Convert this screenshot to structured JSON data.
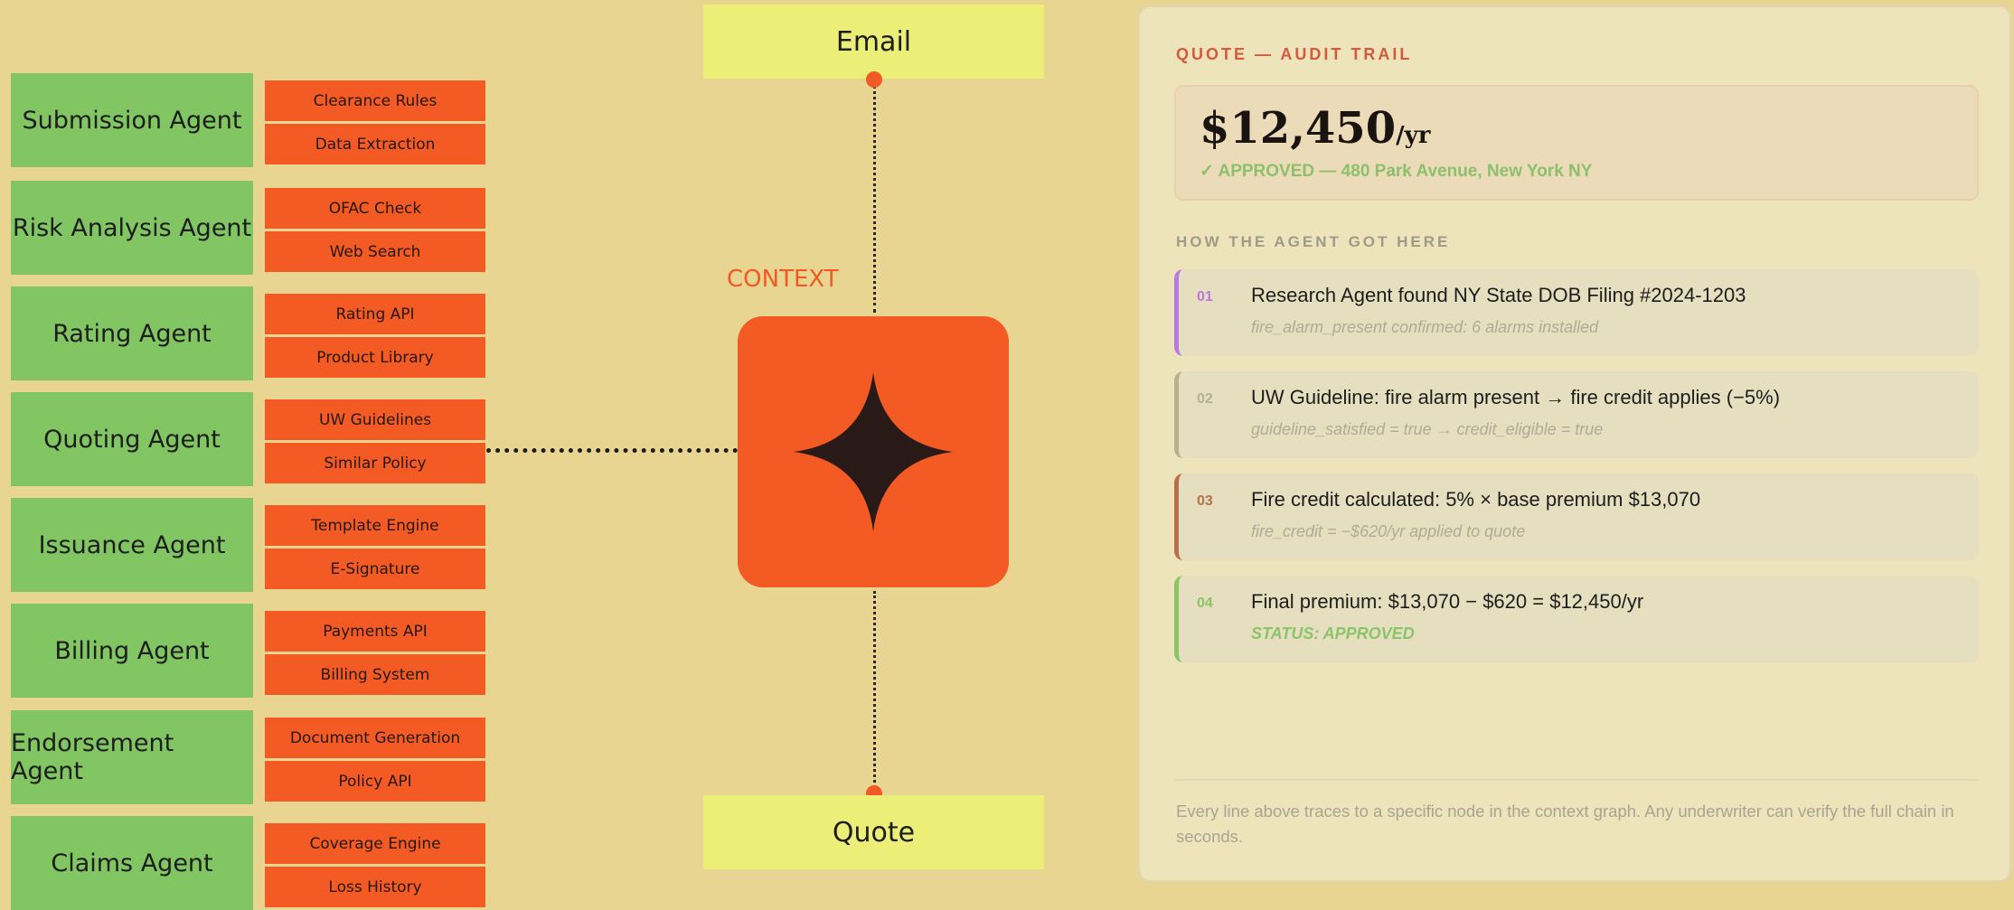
{
  "agents": [
    {
      "name": "Submission Agent",
      "tools": [
        "Clearance Rules",
        "Data Extraction"
      ]
    },
    {
      "name": "Risk Analysis Agent",
      "tools": [
        "OFAC Check",
        "Web Search"
      ]
    },
    {
      "name": "Rating Agent",
      "tools": [
        "Rating API",
        "Product Library"
      ]
    },
    {
      "name": "Quoting Agent",
      "tools": [
        "UW Guidelines",
        "Similar Policy"
      ]
    },
    {
      "name": "Issuance Agent",
      "tools": [
        "Template Engine",
        "E-Signature"
      ]
    },
    {
      "name": "Billing Agent",
      "tools": [
        "Payments API",
        "Billing System"
      ]
    },
    {
      "name": "Endorsement Agent",
      "tools": [
        "Document Generation",
        "Policy API"
      ]
    },
    {
      "name": "Claims Agent",
      "tools": [
        "Coverage Engine",
        "Loss History"
      ]
    }
  ],
  "flow": {
    "input_label": "Email",
    "output_label": "Quote",
    "context_label": "CONTEXT",
    "core_icon": "four-point-star-icon"
  },
  "panel": {
    "title": "QUOTE — AUDIT TRAIL",
    "price": "$12,450",
    "price_unit": "/yr",
    "status_line": "✓ APPROVED — 480 Park Avenue, New York NY",
    "section_label": "HOW THE AGENT GOT HERE",
    "steps": [
      {
        "num": "01",
        "title": "Research Agent found NY State DOB Filing #2024-1203",
        "sub": "fire_alarm_present confirmed: 6 alarms installed",
        "color": "#b97ae0"
      },
      {
        "num": "02",
        "title": "UW Guideline: fire alarm present → fire credit applies (−5%)",
        "sub": "guideline_satisfied = true → credit_eligible = true",
        "color": "#b5b18c"
      },
      {
        "num": "03",
        "title": "Fire credit calculated: 5% × base premium $13,070",
        "sub": "fire_credit = −$620/yr applied to quote",
        "color": "#b86f4e"
      },
      {
        "num": "04",
        "title": "Final premium: $13,070 − $620 = $12,450/yr",
        "sub": "STATUS: APPROVED",
        "color": "#8cc46a"
      }
    ],
    "footer": "Every line above traces to a specific node in the context graph. Any underwriter can verify the full chain in seconds."
  },
  "colors": {
    "background": "#e8d592",
    "agent": "#81c662",
    "tool": "#f45a23",
    "io_box": "#ebee77",
    "accent": "#f15a24"
  }
}
